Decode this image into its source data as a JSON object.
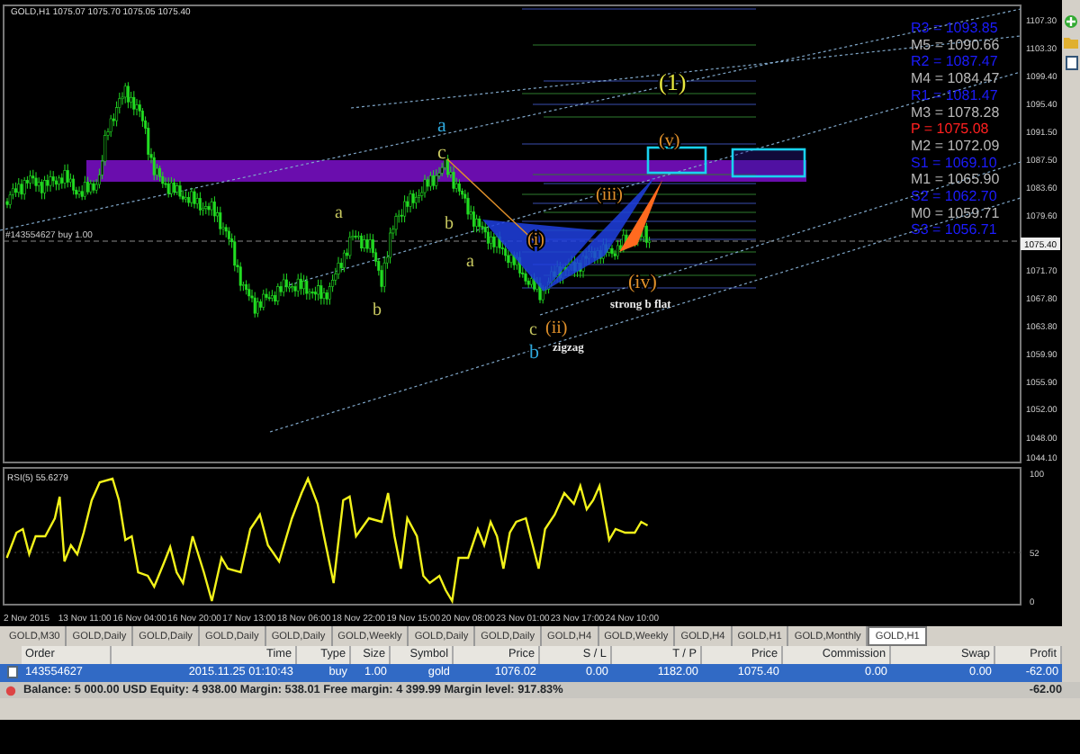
{
  "chart": {
    "symbol": "GOLD,H1",
    "ohlc": [
      "1075.07",
      "1075.70",
      "1075.05",
      "1075.40"
    ],
    "order_line": "#143554627 buy 1.00",
    "current_price": "1075.40",
    "price_axis": [
      "1107.30",
      "1103.30",
      "1099.40",
      "1095.40",
      "1091.50",
      "1087.50",
      "1083.60",
      "1079.60",
      "1071.70",
      "1067.80",
      "1063.80",
      "1059.90",
      "1055.90",
      "1052.00",
      "1048.00",
      "1044.10"
    ],
    "wave_labels": [
      {
        "text": "(1)",
        "color": "#e8e840"
      },
      {
        "text": "a",
        "color": "#2fa8dc"
      },
      {
        "text": "(v)",
        "color": "#e0902a"
      },
      {
        "text": "c",
        "color": "#c8c860"
      },
      {
        "text": "(iii)",
        "color": "#e0902a"
      },
      {
        "text": "a",
        "color": "#c8c860"
      },
      {
        "text": "b",
        "color": "#c8c860"
      },
      {
        "text": "(i)",
        "color": "#e0902a"
      },
      {
        "text": "a",
        "color": "#c8c860"
      },
      {
        "text": "(iv)",
        "color": "#e0902a"
      },
      {
        "text": "b",
        "color": "#c8c860"
      },
      {
        "text": "(ii)",
        "color": "#e0902a"
      },
      {
        "text": "c",
        "color": "#c8c860"
      },
      {
        "text": "b",
        "color": "#2fa8dc"
      }
    ],
    "annotations": [
      "strong b flat",
      "zigzag"
    ],
    "pivot_levels": [
      {
        "kind": "resistance",
        "text": "R3 = 1093.85"
      },
      {
        "kind": "mid",
        "text": "M5 = 1090.66"
      },
      {
        "kind": "resistance",
        "text": "R2 = 1087.47"
      },
      {
        "kind": "mid",
        "text": "M4 = 1084.47"
      },
      {
        "kind": "resistance",
        "text": "R1 = 1081.47"
      },
      {
        "kind": "mid",
        "text": "M3 = 1078.28"
      },
      {
        "kind": "pivot",
        "text": "P = 1075.08"
      },
      {
        "kind": "mid",
        "text": "M2 = 1072.09"
      },
      {
        "kind": "support",
        "text": "S1 = 1069.10"
      },
      {
        "kind": "mid",
        "text": "M1 = 1065.90"
      },
      {
        "kind": "support",
        "text": "S2 = 1062.70"
      },
      {
        "kind": "mid",
        "text": "M0 = 1059.71"
      },
      {
        "kind": "support",
        "text": "S3 = 1056.71"
      }
    ]
  },
  "indicator": {
    "title": "RSI(5) 55.6279",
    "axis": [
      "100",
      "52",
      "0"
    ]
  },
  "time_axis": [
    "2 Nov 2015",
    "13 Nov 11:00",
    "16 Nov 04:00",
    "16 Nov 20:00",
    "17 Nov 13:00",
    "18 Nov 06:00",
    "18 Nov 22:00",
    "19 Nov 15:00",
    "20 Nov 08:00",
    "23 Nov 01:00",
    "23 Nov 17:00",
    "24 Nov 10:00"
  ],
  "chart_tabs": [
    {
      "label": "GOLD,M30",
      "selected": false
    },
    {
      "label": "GOLD,Daily",
      "selected": false
    },
    {
      "label": "GOLD,Daily",
      "selected": false
    },
    {
      "label": "GOLD,Daily",
      "selected": false
    },
    {
      "label": "GOLD,Daily",
      "selected": false
    },
    {
      "label": "GOLD,Weekly",
      "selected": false
    },
    {
      "label": "GOLD,Daily",
      "selected": false
    },
    {
      "label": "GOLD,Daily",
      "selected": false
    },
    {
      "label": "GOLD,H4",
      "selected": false
    },
    {
      "label": "GOLD,Weekly",
      "selected": false
    },
    {
      "label": "GOLD,H4",
      "selected": false
    },
    {
      "label": "GOLD,H1",
      "selected": false
    },
    {
      "label": "GOLD,Monthly",
      "selected": false
    },
    {
      "label": "GOLD,H1",
      "selected": true
    }
  ],
  "terminal": {
    "columns": [
      "Order",
      "Time",
      "Type",
      "Size",
      "Symbol",
      "Price",
      "S / L",
      "T / P",
      "Price",
      "Commission",
      "Swap",
      "Profit"
    ],
    "rows": [
      {
        "selected": true,
        "cells": [
          "143554627",
          "2015.11.25 01:10:43",
          "buy",
          "1.00",
          "gold",
          "1076.02",
          "0.00",
          "1182.00",
          "1075.40",
          "0.00",
          "0.00",
          "-62.00"
        ]
      }
    ],
    "summary": {
      "text": "Balance: 5 000.00 USD  Equity: 4 938.00  Margin: 538.01  Free margin: 4 399.99  Margin level: 917.83%",
      "profit": "-62.00"
    }
  }
}
